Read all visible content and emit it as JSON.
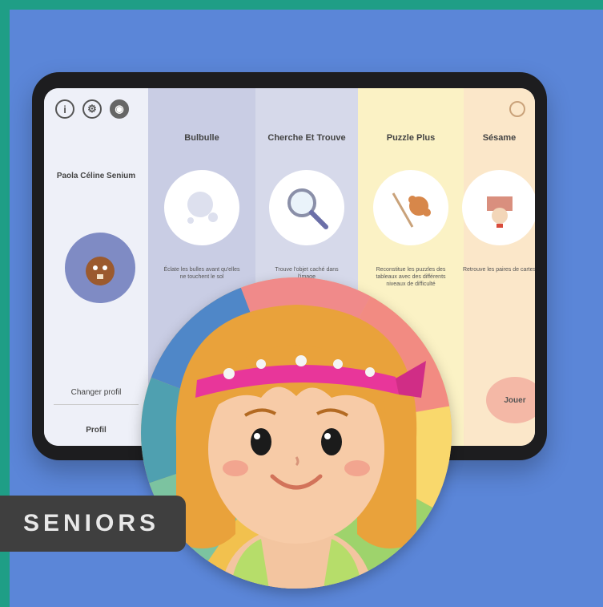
{
  "screen": {
    "top_icons": [
      {
        "name": "info-icon",
        "glyph": "i"
      },
      {
        "name": "settings-icon",
        "glyph": "⚙"
      },
      {
        "name": "sound-icon",
        "glyph": "◉"
      }
    ],
    "profile": {
      "name": "Paola Céline Senium",
      "change_button": "Changer profil",
      "profil_button": "Profil"
    },
    "games": [
      {
        "title": "Bulbulle",
        "icon": "bulb-icon",
        "description": "Éclate les bulles avant qu'elles ne touchent le sol"
      },
      {
        "title": "Cherche Et Trouve",
        "icon": "magnifier-icon",
        "description": "Trouve l'objet caché dans l'image"
      },
      {
        "title": "Puzzle Plus",
        "icon": "puzzle-icon",
        "description": "Reconstitue les puzzles des tableaux avec des différents niveaux de difficulté"
      },
      {
        "title": "Sésame",
        "icon": "hat-icon",
        "description": "Retrouve les paires de cartes"
      }
    ],
    "start_button": "Jouer"
  },
  "badge": {
    "label": "SENIORS"
  },
  "colors": {
    "frame": "#1f9e86",
    "background": "#5b86d8",
    "badge": "#3f3f3f",
    "headband": "#e8369a",
    "hair": "#e9a23b"
  }
}
